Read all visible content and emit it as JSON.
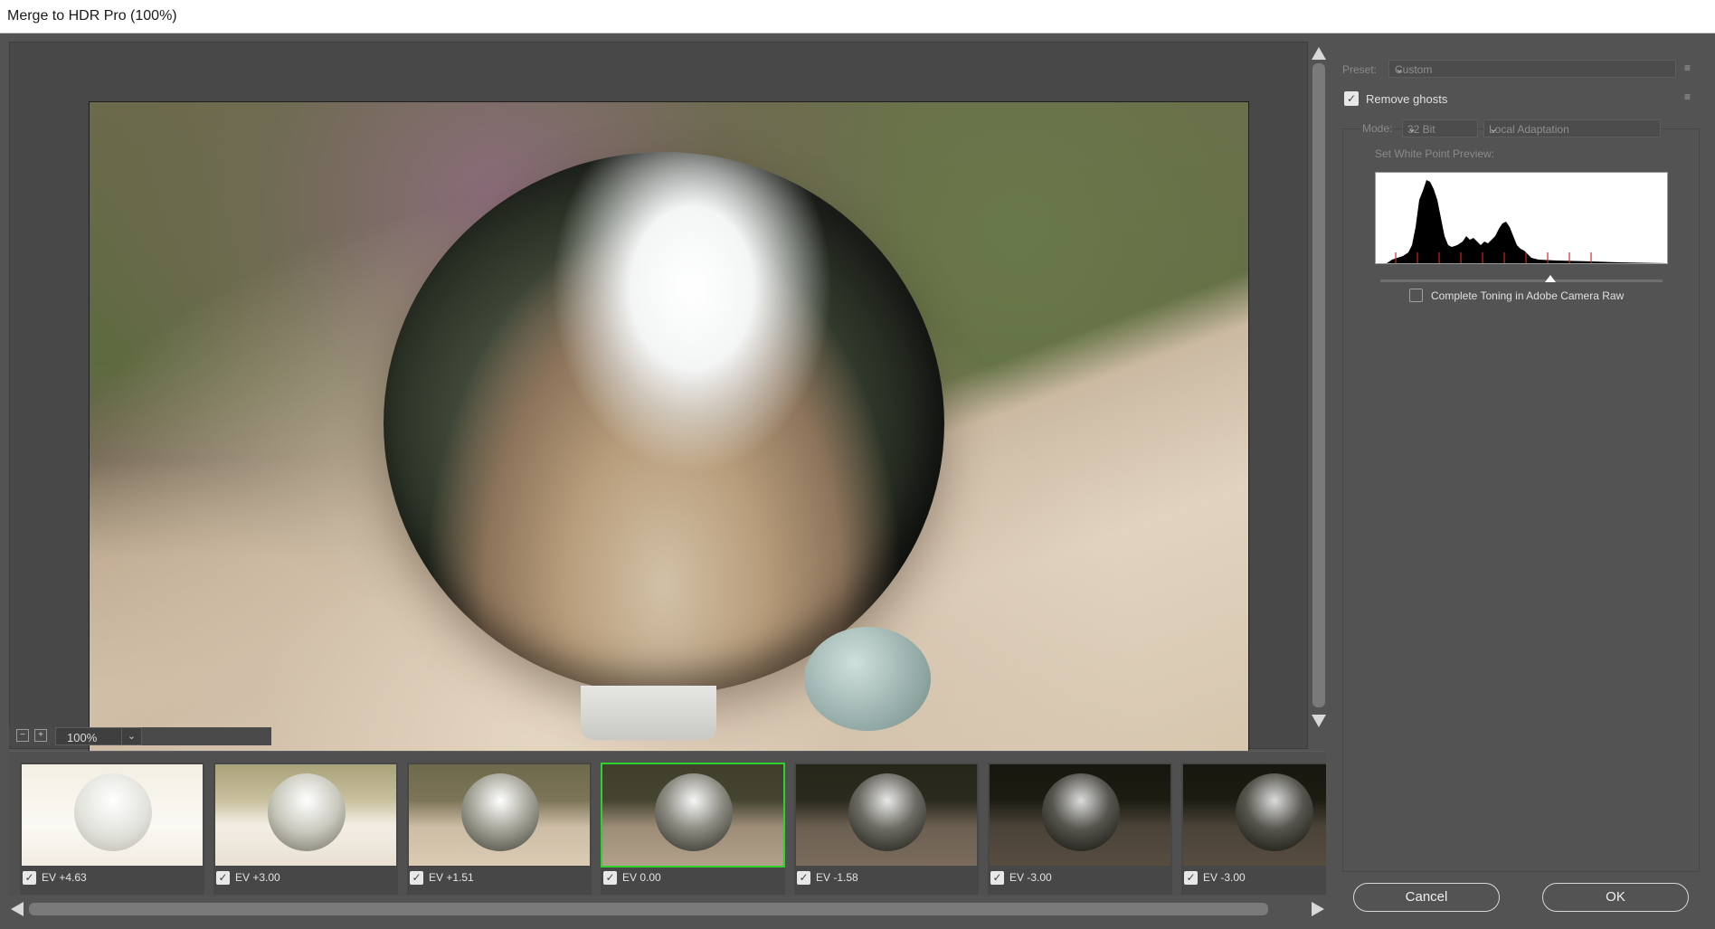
{
  "window": {
    "title": "Merge to HDR Pro (100%)"
  },
  "zoom": {
    "value": "100%",
    "zoom_out_glyph": "−",
    "zoom_in_glyph": "+"
  },
  "thumbnails": [
    {
      "ev": "EV +4.63",
      "checked": true,
      "selected": false
    },
    {
      "ev": "EV +3.00",
      "checked": true,
      "selected": false
    },
    {
      "ev": "EV +1.51",
      "checked": true,
      "selected": false
    },
    {
      "ev": "EV 0.00",
      "checked": true,
      "selected": true
    },
    {
      "ev": "EV -1.58",
      "checked": true,
      "selected": false
    },
    {
      "ev": "EV -3.00",
      "checked": true,
      "selected": false
    },
    {
      "ev": "EV -3.00",
      "checked": true,
      "selected": false
    }
  ],
  "panel": {
    "preset_label": "Preset:",
    "preset_value": "Custom",
    "remove_ghosts_label": "Remove ghosts",
    "remove_ghosts_checked": true,
    "mode_label": "Mode:",
    "bit_depth_value": "32 Bit",
    "method_value": "Local Adaptation",
    "white_point_label": "Set White Point Preview:",
    "complete_toning_label": "Complete Toning in Adobe Camera Raw",
    "complete_toning_checked": false,
    "cancel_label": "Cancel",
    "ok_label": "OK"
  },
  "icons": {
    "checkmark": "✓",
    "chevron_down": "⌄",
    "panel_menu": "≡"
  },
  "colors": {
    "selected_outline": "#2fd12f",
    "dialog_bg": "#535353"
  }
}
